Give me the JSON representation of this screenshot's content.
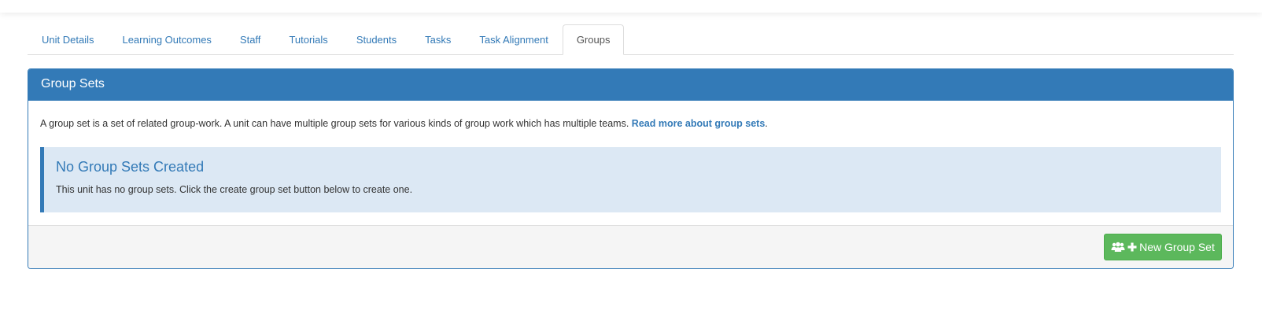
{
  "tabs": [
    {
      "label": "Unit Details",
      "active": false
    },
    {
      "label": "Learning Outcomes",
      "active": false
    },
    {
      "label": "Staff",
      "active": false
    },
    {
      "label": "Tutorials",
      "active": false
    },
    {
      "label": "Students",
      "active": false
    },
    {
      "label": "Tasks",
      "active": false
    },
    {
      "label": "Task Alignment",
      "active": false
    },
    {
      "label": "Groups",
      "active": true
    }
  ],
  "panel": {
    "title": "Group Sets",
    "intro_text": "A group set is a set of related group-work. A unit can have multiple group sets for various kinds of group work which has multiple teams.",
    "read_more_link": "Read more about group sets",
    "read_more_suffix": ".",
    "empty_title": "No Group Sets Created",
    "empty_text": "This unit has no group sets. Click the create group set button below to create one."
  },
  "footer": {
    "new_button_label": "New Group Set",
    "new_button_icons": [
      "users-icon",
      "plus-icon"
    ]
  },
  "colors": {
    "primary": "#337ab7",
    "success": "#5cb85c",
    "info_bg": "#dce8f4"
  }
}
